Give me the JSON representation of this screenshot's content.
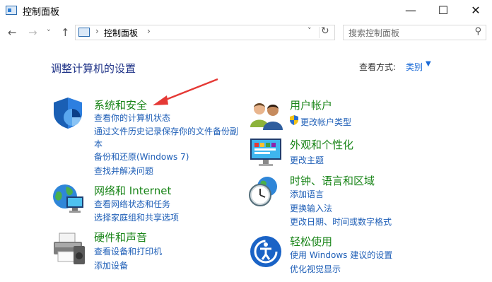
{
  "window": {
    "title": "控制面板",
    "minimize": "—",
    "maximize": "☐",
    "close": "✕"
  },
  "nav": {
    "back": "←",
    "forward": "→",
    "recent": "˅",
    "up": "↑",
    "breadcrumb_sep": "›",
    "address": "控制面板",
    "address_sep2": "›",
    "dropdown": "˅",
    "refresh": "↻",
    "search_placeholder": "搜索控制面板",
    "search_glyph": "⚲"
  },
  "main": {
    "heading": "调整计算机的设置",
    "view_by_label": "查看方式:",
    "view_by_value": "类别",
    "view_by_caret": "▼"
  },
  "categories": {
    "security": {
      "title": "系统和安全",
      "links": [
        "查看你的计算机状态",
        "通过文件历史记录保存你的文件备份副",
        "本",
        "备份和还原(Windows 7)",
        "查找并解决问题"
      ]
    },
    "network": {
      "title": "网络和 Internet",
      "links": [
        "查看网络状态和任务",
        "选择家庭组和共享选项"
      ]
    },
    "hardware": {
      "title": "硬件和声音",
      "links": [
        "查看设备和打印机",
        "添加设备"
      ]
    },
    "users": {
      "title": "用户帐户",
      "links": [
        "更改帐户类型"
      ]
    },
    "appearance": {
      "title": "外观和个性化",
      "links": [
        "更改主题"
      ]
    },
    "clock": {
      "title": "时钟、语言和区域",
      "links": [
        "添加语言",
        "更换输入法",
        "更改日期、时间或数字格式"
      ]
    },
    "ease": {
      "title": "轻松使用",
      "links": [
        "使用 Windows 建议的设置",
        "优化视觉显示"
      ]
    }
  },
  "colors": {
    "category_title": "#188417",
    "link": "#1f5fb7",
    "heading": "#1e3287",
    "annotation_arrow": "#e53935"
  }
}
